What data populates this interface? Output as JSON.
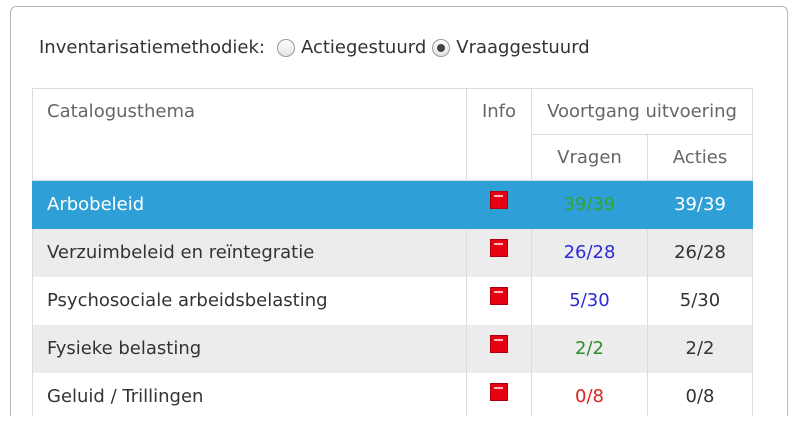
{
  "method": {
    "label": "Inventarisatiemethodiek:",
    "options": [
      {
        "label": "Actiegestuurd",
        "selected": false
      },
      {
        "label": "Vraaggestuurd",
        "selected": true
      }
    ]
  },
  "table": {
    "headers": {
      "catalogusthema": "Catalogusthema",
      "info": "Info",
      "voortgang": "Voortgang uitvoering",
      "vragen": "Vragen",
      "acties": "Acties"
    },
    "rows": [
      {
        "thema": "Arbobeleid",
        "info_icon": "acq-icon",
        "vragen": "39/39",
        "vragen_color": "green",
        "acties": "39/39",
        "selected": true
      },
      {
        "thema": "Verzuimbeleid en reïntegratie",
        "info_icon": "acq-icon",
        "vragen": "26/28",
        "vragen_color": "blue",
        "acties": "26/28"
      },
      {
        "thema": "Psychosociale arbeidsbelasting",
        "info_icon": "acq-icon",
        "vragen": "5/30",
        "vragen_color": "blue",
        "acties": "5/30"
      },
      {
        "thema": "Fysieke belasting",
        "info_icon": "acq-icon",
        "vragen": "2/2",
        "vragen_color": "green",
        "acties": "2/2"
      },
      {
        "thema": "Geluid / Trillingen",
        "info_icon": "acq-icon",
        "vragen": "0/8",
        "vragen_color": "red",
        "acties": "0/8"
      }
    ]
  },
  "colors": {
    "selected_row": "#2f9fd8",
    "alt_row": "#ececec",
    "green": "#2e8b2e",
    "blue": "#2a2ad6",
    "red": "#e02020",
    "icon_red": "#e60012"
  }
}
